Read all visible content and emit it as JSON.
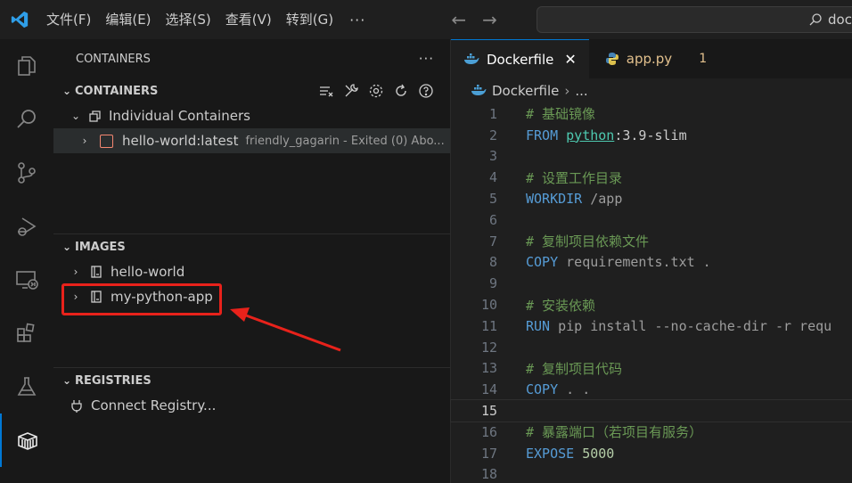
{
  "titlebar": {
    "menu": [
      "文件(F)",
      "编辑(E)",
      "选择(S)",
      "查看(V)",
      "转到(G)"
    ],
    "more": "···",
    "search_text": "doc"
  },
  "sidebar": {
    "header": "CONTAINERS",
    "header_more": "···",
    "containers_section": "CONTAINERS",
    "group_label": "Individual Containers",
    "container": {
      "name": "hello-world:latest",
      "description": "friendly_gagarin - Exited (0) Abo..."
    },
    "images_section": "IMAGES",
    "images": [
      "hello-world",
      "my-python-app"
    ],
    "registries_section": "REGISTRIES",
    "connect_registry": "Connect Registry..."
  },
  "editor": {
    "tabs": [
      {
        "label": "Dockerfile",
        "close": "✕"
      },
      {
        "label": "app.py",
        "badge": "1"
      }
    ],
    "breadcrumb": {
      "file": "Dockerfile",
      "rest": "..."
    },
    "lines": [
      {
        "n": "1",
        "a": "# 基础镜像",
        "b": "",
        "c": ""
      },
      {
        "n": "2",
        "a": "FROM",
        "b": "python",
        "c": ":3.9-slim"
      },
      {
        "n": "3",
        "a": "",
        "b": "",
        "c": ""
      },
      {
        "n": "4",
        "a": "# 设置工作目录",
        "b": "",
        "c": ""
      },
      {
        "n": "5",
        "a": "WORKDIR",
        "b": "",
        "c": " /app"
      },
      {
        "n": "6",
        "a": "",
        "b": "",
        "c": ""
      },
      {
        "n": "7",
        "a": "# 复制项目依赖文件",
        "b": "",
        "c": ""
      },
      {
        "n": "8",
        "a": "COPY",
        "b": "",
        "c": " requirements.txt ."
      },
      {
        "n": "9",
        "a": "",
        "b": "",
        "c": ""
      },
      {
        "n": "10",
        "a": "# 安装依赖",
        "b": "",
        "c": ""
      },
      {
        "n": "11",
        "a": "RUN",
        "b": "",
        "c": " pip install --no-cache-dir -r requ"
      },
      {
        "n": "12",
        "a": "",
        "b": "",
        "c": ""
      },
      {
        "n": "13",
        "a": "# 复制项目代码",
        "b": "",
        "c": ""
      },
      {
        "n": "14",
        "a": "COPY",
        "b": "",
        "c": " . ."
      },
      {
        "n": "15",
        "a": "",
        "b": "",
        "c": ""
      },
      {
        "n": "16",
        "a": "# 暴露端口（若项目有服务）",
        "b": "",
        "c": ""
      },
      {
        "n": "17",
        "a": "EXPOSE",
        "b": "",
        "c": " 5000"
      },
      {
        "n": "18",
        "a": "",
        "b": "",
        "c": ""
      }
    ]
  },
  "colors": {
    "accent": "#0078d4",
    "annotation": "#e8221b",
    "comment": "#6a9955",
    "keyword": "#569cd6"
  }
}
